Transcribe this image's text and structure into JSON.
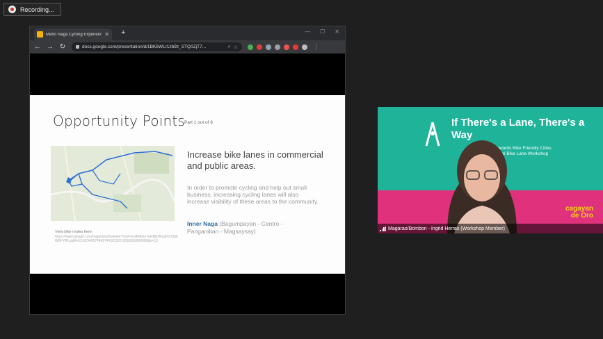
{
  "recording": {
    "label": "Recording..."
  },
  "browser": {
    "tab_title": "Metro Naga Cycling Experience",
    "url": "docs.google.com/presentation/d/1BK6WLr1zb9z_STQ0ZjT7...",
    "new_tab_symbol": "+",
    "extensions": [
      "#4caf50",
      "#e53935",
      "#90a4ae",
      "#9e9e9e",
      "#ef5350",
      "#e53935",
      "#bdbdbd"
    ]
  },
  "slide": {
    "title": "Opportunity Points",
    "part": "Part 1 out of 6",
    "heading": "Increase bike lanes in commercial and public areas.",
    "body": "In order to promote cycling and help out small business, increasing cycling lanes will also increase visibility of these areas to the community.",
    "inner_label": "Inner Naga",
    "inner_detail": " (Bagumpayan - Centro - Panganiban - Magsaysay)",
    "map_caption": "View bike routes here:",
    "map_link": "https://www.google.com/maps/d/u/0/viewer?mid=1ra4BKEoTuR8ijO6ncjFhO3p6W5FYfMLp&ll=13.6234657494374%2C123.2055950000000&z=13"
  },
  "video": {
    "poster_title": "If There's a Lane, There's a Way",
    "poster_sub": "Towards Bike Friendly Cities\nLocal Bike Lane Workshop",
    "brand": "cagayan\nde Oro",
    "participant": "Magarao/Bombon - Ingrid Herras (Workshop Member)"
  }
}
